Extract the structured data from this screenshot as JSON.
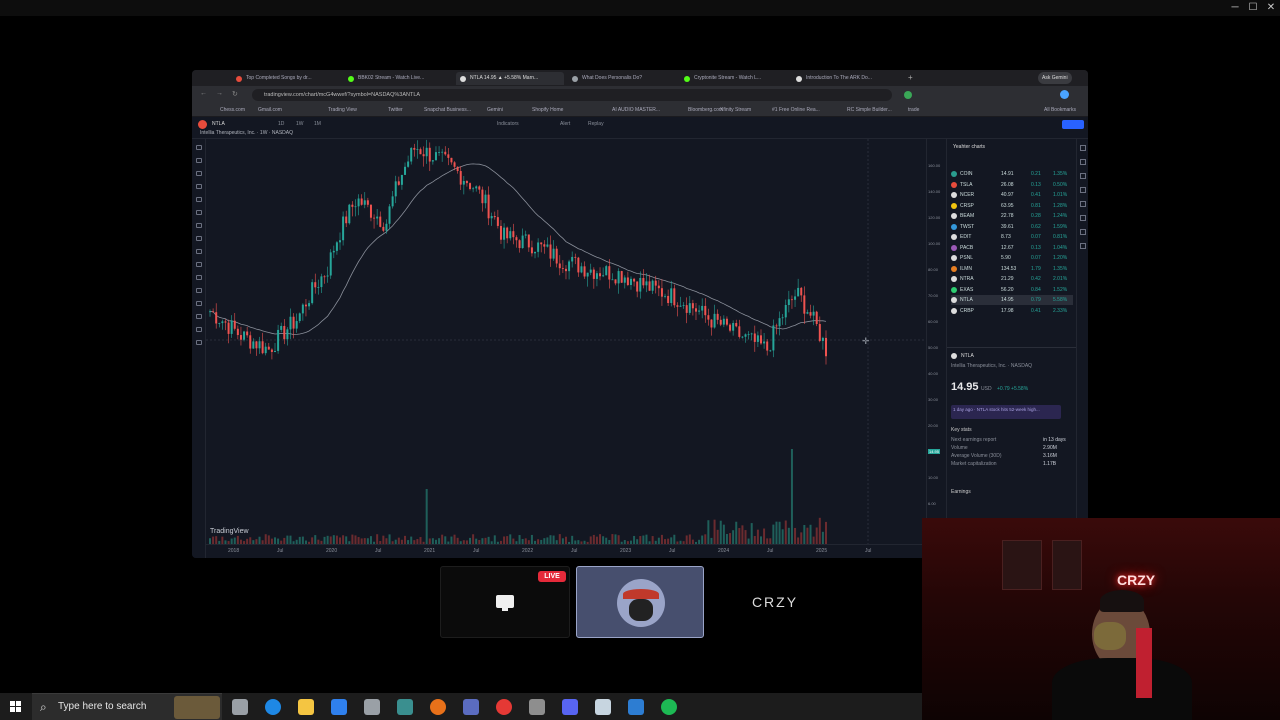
{
  "window": {
    "minimize_glyph": "─",
    "maximize_glyph": "☐",
    "close_glyph": "✕"
  },
  "browser": {
    "tabs": [
      {
        "title": "Top Completed Songs by dr...",
        "color": "#e74c3c",
        "active": false
      },
      {
        "title": "BBK02 Stream - Watch Live...",
        "color": "#53fc18",
        "active": false
      },
      {
        "title": "NTLA 14.95 ▲ +5.58% Marn...",
        "color": "#dddddd",
        "active": true
      },
      {
        "title": "What Does Personalis Do?",
        "color": "#9aa0a6",
        "active": false
      },
      {
        "title": "Cryptonite Stream - Watch L...",
        "color": "#53fc18",
        "active": false
      },
      {
        "title": "Introduction To The ARK Do...",
        "color": "#dddddd",
        "active": false
      }
    ],
    "ask_label": "Ask Gemini",
    "url": "tradingview.com/chart/mcG4wwef/?symbol=NASDAQ%3ANTLA",
    "bookmarks": [
      "Chess.com",
      "Gmail.com",
      "Trading View",
      "Twitter",
      "Snapchat Business...",
      "Gemini",
      "Shopify Home",
      "AI AUDIO MASTER...",
      "Bloomberg.com",
      "Xfinity Stream",
      "#1 Free Online Rea...",
      "RC Simple Builder...",
      "trade",
      "All Bookmarks"
    ]
  },
  "tradingview": {
    "symbol_tag": "NTLA",
    "symbol_title": "Intellia Therapeutics, Inc. · 1W · NASDAQ",
    "watermark": "TradingView",
    "toolbar_items": [
      "1D",
      "1W",
      "1M",
      "Indicators",
      "Alert",
      "Replay"
    ],
    "time_labels": [
      "2018",
      "Jul",
      "2020",
      "Jul",
      "2021",
      "Jul",
      "2022",
      "Jul",
      "2023",
      "Jul",
      "2024",
      "Jul",
      "2025",
      "Jul"
    ],
    "price_labels": [
      "160.00",
      "140.00",
      "120.00",
      "100.00",
      "80.00",
      "70.00",
      "60.00",
      "50.00",
      "40.00",
      "30.00",
      "20.00",
      "14.95",
      "10.00",
      "6.00"
    ],
    "watchlist_title": "Yeahter charts",
    "watchlist": [
      {
        "sym": "COIN",
        "last": "14.91",
        "chg": "0.21",
        "pct": "1.35%",
        "color": "#2a9d8f"
      },
      {
        "sym": "TSLA",
        "last": "26.08",
        "chg": "0.13",
        "pct": "0.50%",
        "color": "#e74c3c"
      },
      {
        "sym": "NCER",
        "last": "40.97",
        "chg": "0.41",
        "pct": "1.01%",
        "color": "#dddddd"
      },
      {
        "sym": "CRSP",
        "last": "63.95",
        "chg": "0.81",
        "pct": "1.28%",
        "color": "#f1c40f"
      },
      {
        "sym": "BEAM",
        "last": "22.78",
        "chg": "0.28",
        "pct": "1.24%",
        "color": "#dddddd"
      },
      {
        "sym": "TWST",
        "last": "39.61",
        "chg": "0.62",
        "pct": "1.59%",
        "color": "#3498db"
      },
      {
        "sym": "EDIT",
        "last": "8.73",
        "chg": "0.07",
        "pct": "0.81%",
        "color": "#dddddd"
      },
      {
        "sym": "PACB",
        "last": "12.67",
        "chg": "0.13",
        "pct": "1.04%",
        "color": "#9b59b6"
      },
      {
        "sym": "PSNL",
        "last": "5.90",
        "chg": "0.07",
        "pct": "1.20%",
        "color": "#dddddd"
      },
      {
        "sym": "ILMN",
        "last": "134.53",
        "chg": "1.79",
        "pct": "1.35%",
        "color": "#e67e22"
      },
      {
        "sym": "NTRA",
        "last": "21.29",
        "chg": "0.42",
        "pct": "2.01%",
        "color": "#dddddd"
      },
      {
        "sym": "EXAS",
        "last": "56.20",
        "chg": "0.84",
        "pct": "1.52%",
        "color": "#2ecc71"
      },
      {
        "sym": "NTLA",
        "last": "14.95",
        "chg": "0.79",
        "pct": "5.58%",
        "color": "#dddddd",
        "selected": true
      },
      {
        "sym": "CRBP",
        "last": "17.98",
        "chg": "0.41",
        "pct": "2.33%",
        "color": "#dddddd"
      }
    ],
    "detail": {
      "symbol": "NTLA",
      "name": "Intellia Therapeutics, Inc. · NASDAQ",
      "price": "14.95",
      "currency": "USD",
      "change": "+0.79 +5.58%",
      "news": "1 day ago · NTLA stock hits 52-week high...",
      "key_stats_title": "Key stats",
      "stats": [
        "Next earnings report",
        "Volume",
        "Average Volume (30D)",
        "Market capitalization"
      ],
      "stat_values": [
        "in 13 days",
        "2.90M",
        "3.16M",
        "1.17B"
      ],
      "earnings_label": "Earnings"
    }
  },
  "call": {
    "live_label": "LIVE",
    "participant_name": "CRZY"
  },
  "taskbar": {
    "search_placeholder": "Type here to search",
    "icons": [
      "start-icon",
      "search-icon",
      "task-view-icon",
      "edge-icon",
      "file-explorer-icon",
      "calculator-icon",
      "app-icon",
      "app-icon",
      "firefox-icon",
      "app-icon",
      "chrome-icon",
      "app-icon",
      "discord-icon",
      "steam-icon",
      "app-icon",
      "spotify-icon"
    ]
  },
  "webcam": {
    "neon_sign": "CRZY"
  },
  "chart_data": {
    "type": "line",
    "title": "",
    "xlabel": "",
    "ylabel": "",
    "x": [
      "2018",
      "2019",
      "2020",
      "2020-07",
      "2021-01",
      "2021-02",
      "2021-04",
      "2021-09",
      "2021-11",
      "2022-01",
      "2022-04",
      "2022-07",
      "2022-10",
      "2023-01",
      "2023-04",
      "2023-07",
      "2023-10",
      "2024-01",
      "2024-04",
      "2024-07",
      "2024-10",
      "2025-01"
    ],
    "series": [
      {
        "values": [
          24,
          18,
          15,
          22,
          40,
          95,
          70,
          180,
          150,
          110,
          60,
          55,
          45,
          40,
          38,
          32,
          28,
          22,
          18,
          15,
          30,
          15
        ]
      }
    ],
    "ylim": [
      5,
      180
    ]
  }
}
